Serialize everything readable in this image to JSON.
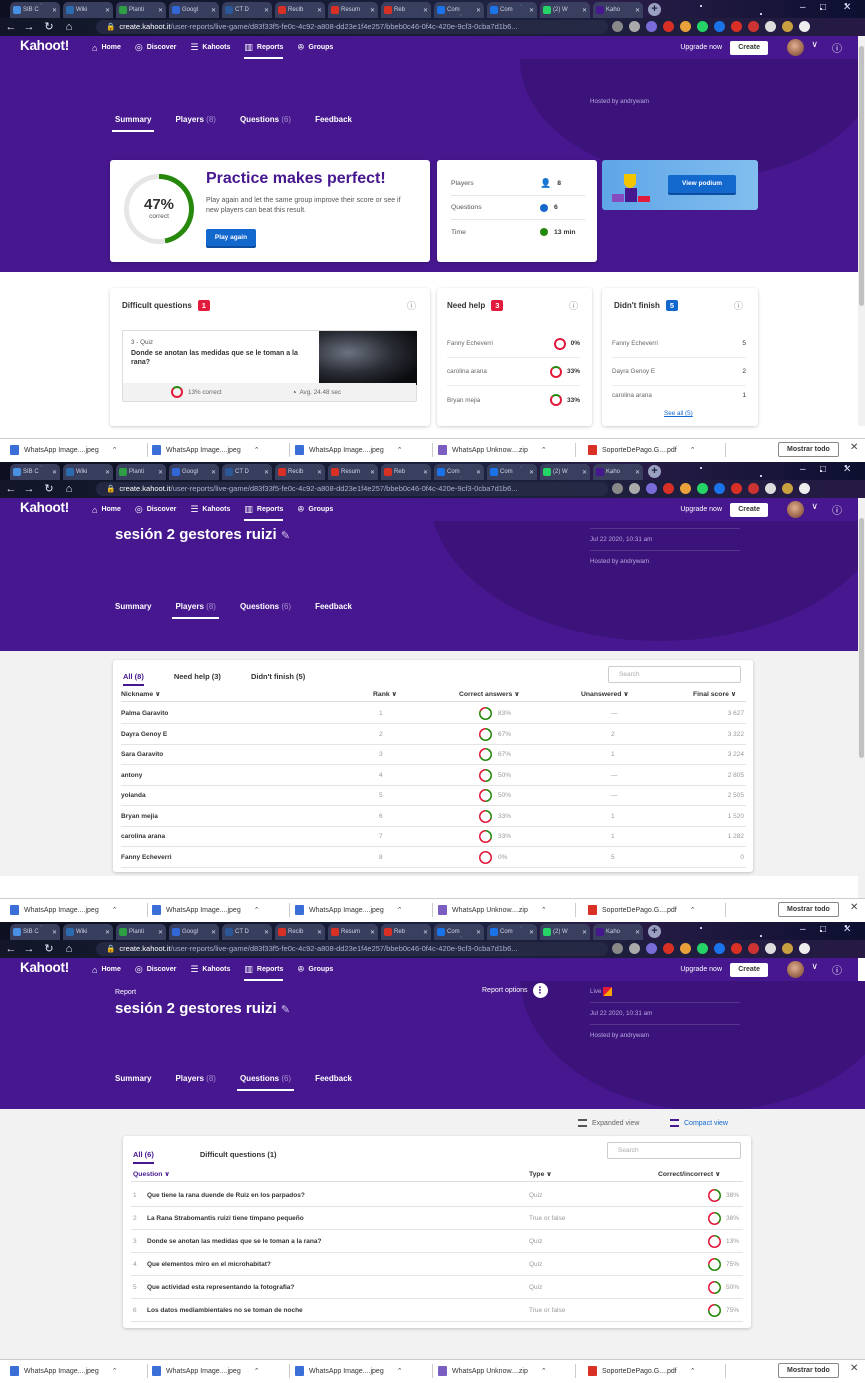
{
  "browser": {
    "tabs": [
      {
        "label": "SIB C",
        "color": "#4a90e2"
      },
      {
        "label": "Wiki",
        "color": "#2b6cb0"
      },
      {
        "label": "Planti",
        "color": "#2e9e44"
      },
      {
        "label": "Googl",
        "color": "#3367d6"
      },
      {
        "label": "CT D",
        "color": "#2b5797"
      },
      {
        "label": "Recib",
        "color": "#d93025"
      },
      {
        "label": "Resum",
        "color": "#d93025"
      },
      {
        "label": "Reb",
        "color": "#d93025"
      },
      {
        "label": "Com",
        "color": "#1a73e8"
      },
      {
        "label": "Com",
        "color": "#1a73e8"
      },
      {
        "label": "(2) W",
        "color": "#25d366"
      },
      {
        "label": "Kaho",
        "color": "#46178f"
      }
    ],
    "url_host": "create.kahoot.it",
    "url_path": "/user-reports/live-game/d83f33f5-fe0c-4c92-a808-dd23e1f4e257/bbeb0c46-0f4c-420e-9cf3-0cba7d1b6..."
  },
  "kahoot_nav": {
    "logo": "Kahoot!",
    "items": [
      {
        "label": "Home",
        "icon": "⌂"
      },
      {
        "label": "Discover",
        "icon": "◎"
      },
      {
        "label": "Kahoots",
        "icon": "☰"
      },
      {
        "label": "Reports",
        "icon": "▥"
      },
      {
        "label": "Groups",
        "icon": "ꔮ"
      }
    ],
    "upgrade": "Upgrade now",
    "create": "Create"
  },
  "report": {
    "label": "Report",
    "title": "sesión 2 gestores ruizi",
    "options": "Report options",
    "live": "Live",
    "date": "Jul 22 2020, 10:31 am",
    "hosted_by": "Hosted by andrywam"
  },
  "subtabs": [
    {
      "label": "Summary",
      "count": ""
    },
    {
      "label": "Players",
      "count": "(8)"
    },
    {
      "label": "Questions",
      "count": "(6)"
    },
    {
      "label": "Feedback",
      "count": ""
    }
  ],
  "summary": {
    "percent": "47%",
    "percent_value": 47,
    "correct": "correct",
    "headline": "Practice makes perfect!",
    "message": "Play again and let the same group improve their score or see if new players can beat this result.",
    "play_again": "Play again",
    "stats": [
      {
        "label": "Players",
        "value": "8",
        "color": "#864cbf"
      },
      {
        "label": "Questions",
        "value": "6",
        "color": "#1368ce"
      },
      {
        "label": "Time",
        "value": "13 min",
        "color": "#26890c"
      }
    ],
    "view_podium": "View podium",
    "difficult": {
      "title": "Difficult questions",
      "count": "1",
      "q_type": "3 - Quiz",
      "q_text": "Donde se anotan las medidas que se le toman a la rana?",
      "correct": "13% correct",
      "avg": "Avg. 24.48 sec"
    },
    "need_help": {
      "title": "Need help",
      "count": "3",
      "rows": [
        {
          "name": "Fanny Echeverri",
          "value": "0%"
        },
        {
          "name": "carolina arana",
          "value": "33%"
        },
        {
          "name": "Bryan mejia",
          "value": "33%"
        }
      ]
    },
    "didnt_finish": {
      "title": "Didn't finish",
      "count": "5",
      "rows": [
        {
          "name": "Fanny Echeverri",
          "value": "5"
        },
        {
          "name": "Dayra Genoy E",
          "value": "2"
        },
        {
          "name": "carolina arana",
          "value": "1"
        }
      ],
      "see_all": "See all (5)"
    }
  },
  "players": {
    "filters": [
      "All (8)",
      "Need help (3)",
      "Didn't finish (5)"
    ],
    "search": "Search",
    "headers": [
      "Nickname ∨",
      "Rank ∨",
      "Correct answers ∨",
      "Unanswered ∨",
      "Final score ∨"
    ],
    "rows": [
      {
        "name": "Palma Garavito",
        "rank": "1",
        "correct": "83%",
        "unanswered": "—",
        "score": "3 627"
      },
      {
        "name": "Dayra Genoy E",
        "rank": "2",
        "correct": "67%",
        "unanswered": "2",
        "score": "3 322"
      },
      {
        "name": "Sara Garavito",
        "rank": "3",
        "correct": "67%",
        "unanswered": "1",
        "score": "3 224"
      },
      {
        "name": "antony",
        "rank": "4",
        "correct": "50%",
        "unanswered": "—",
        "score": "2 805"
      },
      {
        "name": "yolanda",
        "rank": "5",
        "correct": "50%",
        "unanswered": "—",
        "score": "2 505"
      },
      {
        "name": "Bryan mejia",
        "rank": "6",
        "correct": "33%",
        "unanswered": "1",
        "score": "1 520"
      },
      {
        "name": "carolina arana",
        "rank": "7",
        "correct": "33%",
        "unanswered": "1",
        "score": "1 282"
      },
      {
        "name": "Fanny Echeverri",
        "rank": "8",
        "correct": "0%",
        "unanswered": "5",
        "score": "0"
      }
    ]
  },
  "questions": {
    "expanded_view": "Expanded view",
    "compact_view": "Compact view",
    "filters": [
      "All (6)",
      "Difficult questions (1)"
    ],
    "search": "Search",
    "headers": [
      "Question ∨",
      "Type ∨",
      "Correct/incorrect ∨"
    ],
    "rows": [
      {
        "n": "1",
        "text": "Que tiene la rana duende de Ruiz en los parpados?",
        "type": "Quiz",
        "pct": "38%"
      },
      {
        "n": "2",
        "text": "La Rana Strabomantis ruizi tiene tímpano pequeño",
        "type": "True or false",
        "pct": "38%"
      },
      {
        "n": "3",
        "text": "Donde se anotan las medidas que se le toman a la rana?",
        "type": "Quiz",
        "pct": "13%"
      },
      {
        "n": "4",
        "text": "Que elementos miro en el microhabitat?",
        "type": "Quiz",
        "pct": "75%"
      },
      {
        "n": "5",
        "text": "Que actividad esta representando la fotografia?",
        "type": "Quiz",
        "pct": "50%"
      },
      {
        "n": "6",
        "text": "Los datos mediambientales no se toman de noche",
        "type": "True or false",
        "pct": "75%"
      }
    ]
  },
  "downloads": {
    "items": [
      {
        "label": "WhatsApp Image....jpeg",
        "kind": "img"
      },
      {
        "label": "WhatsApp Image....jpeg",
        "kind": "img"
      },
      {
        "label": "WhatsApp Image....jpeg",
        "kind": "img"
      },
      {
        "label": "WhatsApp Unknow....zip",
        "kind": "zip"
      },
      {
        "label": "SoporteDePago.G....pdf",
        "kind": "pdf"
      }
    ],
    "show_all": "Mostrar todo"
  },
  "colors": {
    "brand_purple": "#46178f",
    "blue": "#1368ce",
    "green": "#26890c",
    "red": "#e21b3c",
    "ring_red": "#e21b3c",
    "ring_green": "#26890c"
  }
}
